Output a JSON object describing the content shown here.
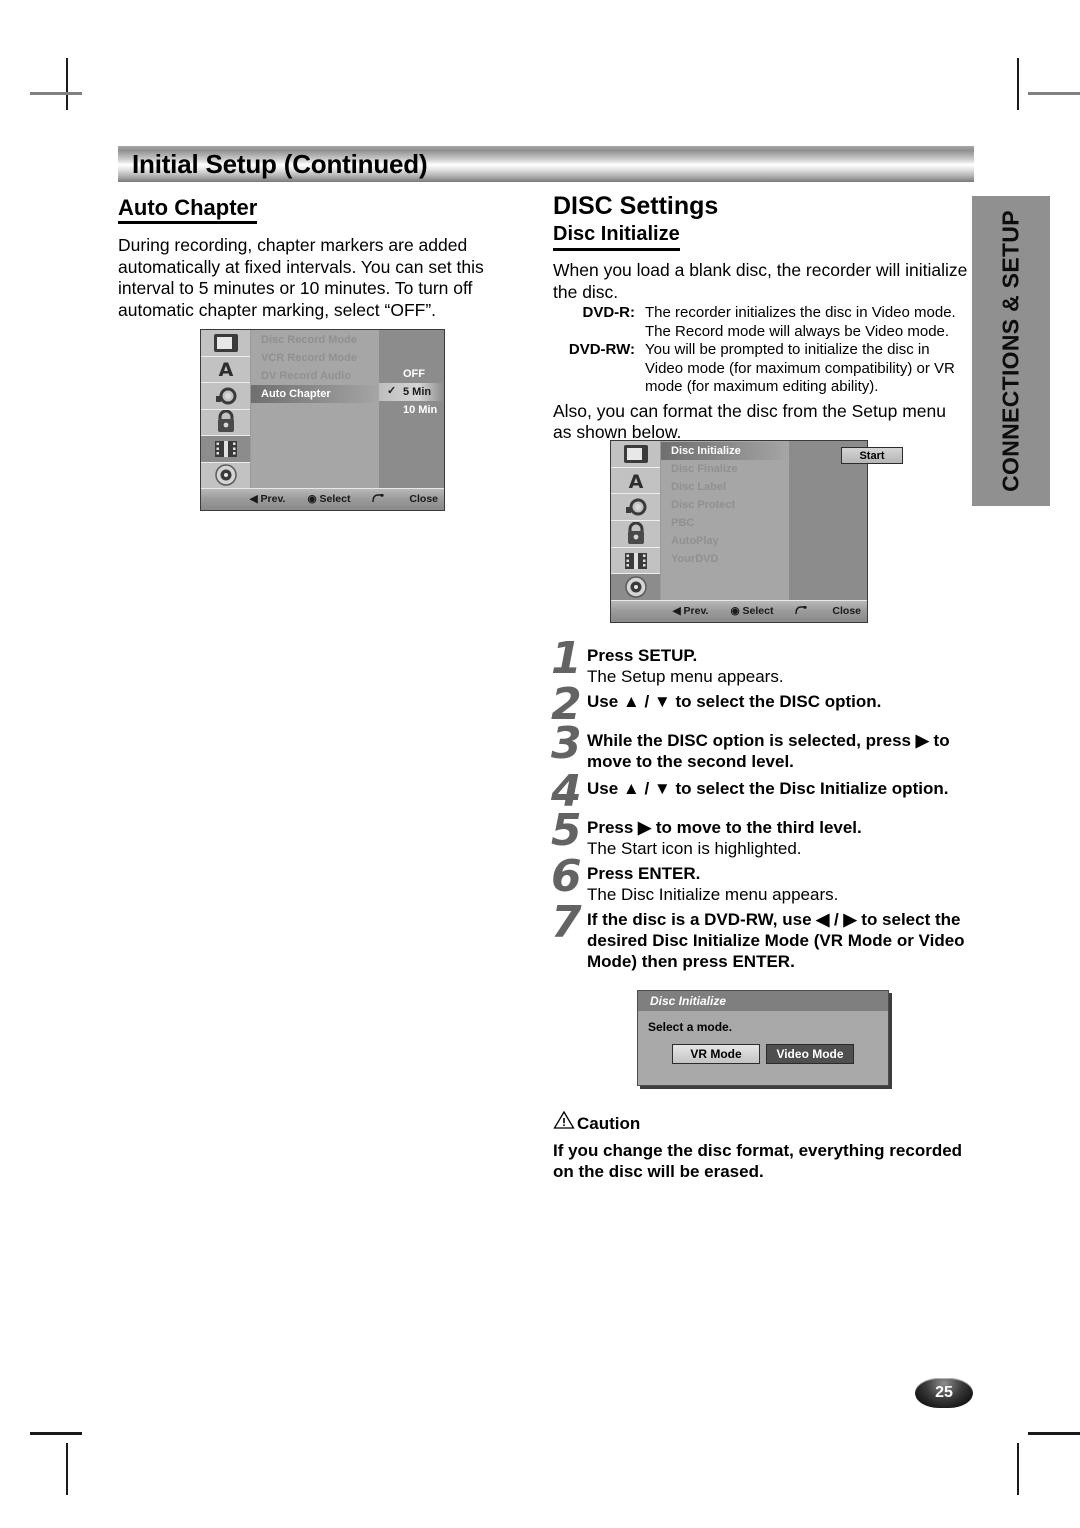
{
  "header": {
    "title": "Initial Setup (Continued)"
  },
  "left_column": {
    "section_title": "Auto Chapter",
    "paragraph": "During recording, chapter markers are added automatically at fixed intervals. You can set this interval to 5 minutes or 10 minutes. To turn off automatic chapter marking, select “OFF”."
  },
  "right_column": {
    "title": "DISC Settings",
    "subtitle": "Disc Initialize",
    "intro": "When you load a blank disc, the recorder will initialize the disc.",
    "definitions": [
      {
        "term": "DVD-R:",
        "desc": "The recorder initializes the disc in Video mode. The Record mode will always be Video mode."
      },
      {
        "term": "DVD-RW:",
        "desc": "You will be prompted to initialize the disc in Video mode (for maximum compatibility) or VR mode (for maximum editing ability)."
      }
    ],
    "outro": "Also, you can format the disc from the Setup menu as shown below."
  },
  "osd_auto_chapter": {
    "icons": [
      "tv-icon",
      "language-icon",
      "audio-icon",
      "lock-icon",
      "film-icon",
      "disc-icon"
    ],
    "active_icon_index": 4,
    "menu_items": [
      {
        "label": "Disc Record Mode",
        "state": "dim"
      },
      {
        "label": "VCR Record Mode",
        "state": "dim"
      },
      {
        "label": "DV Record Audio",
        "state": "dim"
      },
      {
        "label": "Auto Chapter",
        "state": "selected"
      }
    ],
    "options": [
      {
        "label": "OFF",
        "checked": false,
        "highlighted": false
      },
      {
        "label": "5 Min",
        "checked": true,
        "highlighted": true
      },
      {
        "label": "10 Min",
        "checked": false,
        "highlighted": false
      }
    ],
    "footer": {
      "prev": "◀ Prev.",
      "select": "◉ Select",
      "close": "Close"
    }
  },
  "osd_disc_initialize": {
    "icons": [
      "tv-icon",
      "language-icon",
      "audio-icon",
      "lock-icon",
      "film-icon",
      "disc-icon"
    ],
    "active_icon_index": 5,
    "menu_items": [
      {
        "label": "Disc Initialize",
        "state": "selected"
      },
      {
        "label": "Disc Finalize",
        "state": "dim"
      },
      {
        "label": "Disc Label",
        "state": "dim"
      },
      {
        "label": "Disc Protect",
        "state": "dim"
      },
      {
        "label": "PBC",
        "state": "dim"
      },
      {
        "label": "AutoPlay",
        "state": "dim"
      },
      {
        "label": "YourDVD",
        "state": "dim"
      }
    ],
    "start_button": "Start",
    "footer": {
      "prev": "◀ Prev.",
      "select": "◉ Select",
      "close": "Close"
    }
  },
  "steps": [
    {
      "num": "1",
      "bold": "Press SETUP.",
      "plain": "The Setup menu appears."
    },
    {
      "num": "2",
      "bold": "Use ▲ / ▼ to select the DISC option.",
      "plain": ""
    },
    {
      "num": "3",
      "bold": "While the DISC option is selected, press ▶ to move to the second level.",
      "plain": ""
    },
    {
      "num": "4",
      "bold": "Use ▲ / ▼ to select the Disc Initialize option.",
      "plain": ""
    },
    {
      "num": "5",
      "bold": "Press ▶ to move to the third level.",
      "plain": "The Start icon is highlighted."
    },
    {
      "num": "6",
      "bold": "Press ENTER.",
      "plain": "The Disc Initialize menu appears."
    },
    {
      "num": "7",
      "bold": "If the disc is a DVD-RW, use ◀ / ▶ to select the desired Disc Initialize Mode (VR Mode or Video Mode) then press ENTER.",
      "plain": ""
    }
  ],
  "dialog": {
    "title": "Disc Initialize",
    "message": "Select a mode.",
    "buttons": [
      {
        "label": "VR Mode",
        "style": "light"
      },
      {
        "label": "Video Mode",
        "style": "dark"
      }
    ]
  },
  "caution": {
    "heading": "Caution",
    "body": "If you change the disc format, everything recorded on the disc will be erased."
  },
  "side_tab": {
    "label": "CONNECTIONS & SETUP"
  },
  "page_number": "25"
}
